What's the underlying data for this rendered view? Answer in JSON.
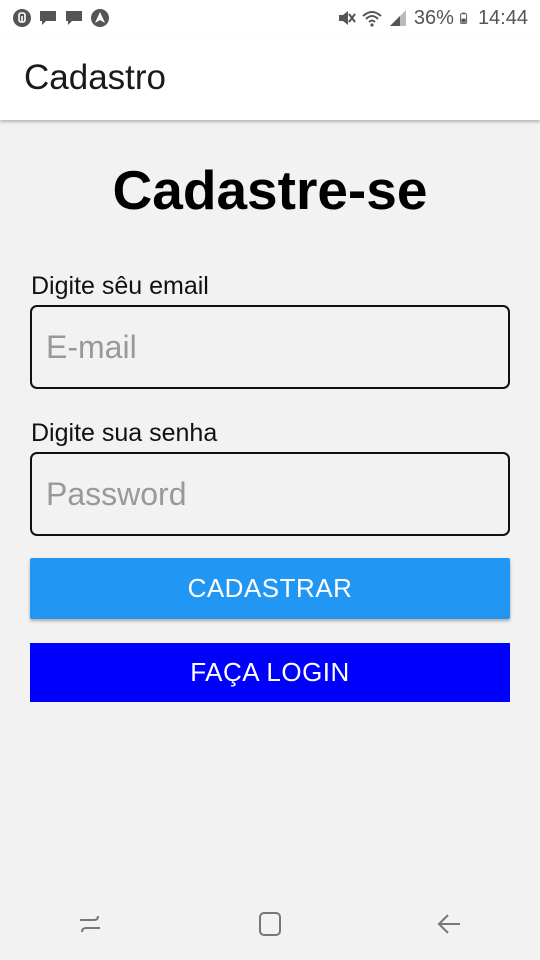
{
  "status_bar": {
    "battery_text": "36%",
    "time": "14:44",
    "left_icons": [
      "notification-app-icon",
      "chat-icon",
      "chat-icon",
      "navigation-icon"
    ],
    "right_icons": [
      "mute-icon",
      "wifi-icon",
      "signal-icon",
      "battery-icon"
    ]
  },
  "app_bar": {
    "title": "Cadastro"
  },
  "form": {
    "heading": "Cadastre-se",
    "email": {
      "label": "Digite sêu email",
      "placeholder": "E-mail",
      "value": ""
    },
    "password": {
      "label": "Digite sua senha",
      "placeholder": "Password",
      "value": ""
    },
    "register_button": "CADASTRAR",
    "login_button": "FAÇA LOGIN"
  },
  "colors": {
    "register_button": "#2196f3",
    "login_button": "#0000ff",
    "background": "#f2f2f2"
  },
  "nav_bar": {
    "buttons": [
      "recent-apps-icon",
      "home-icon",
      "back-icon"
    ]
  }
}
